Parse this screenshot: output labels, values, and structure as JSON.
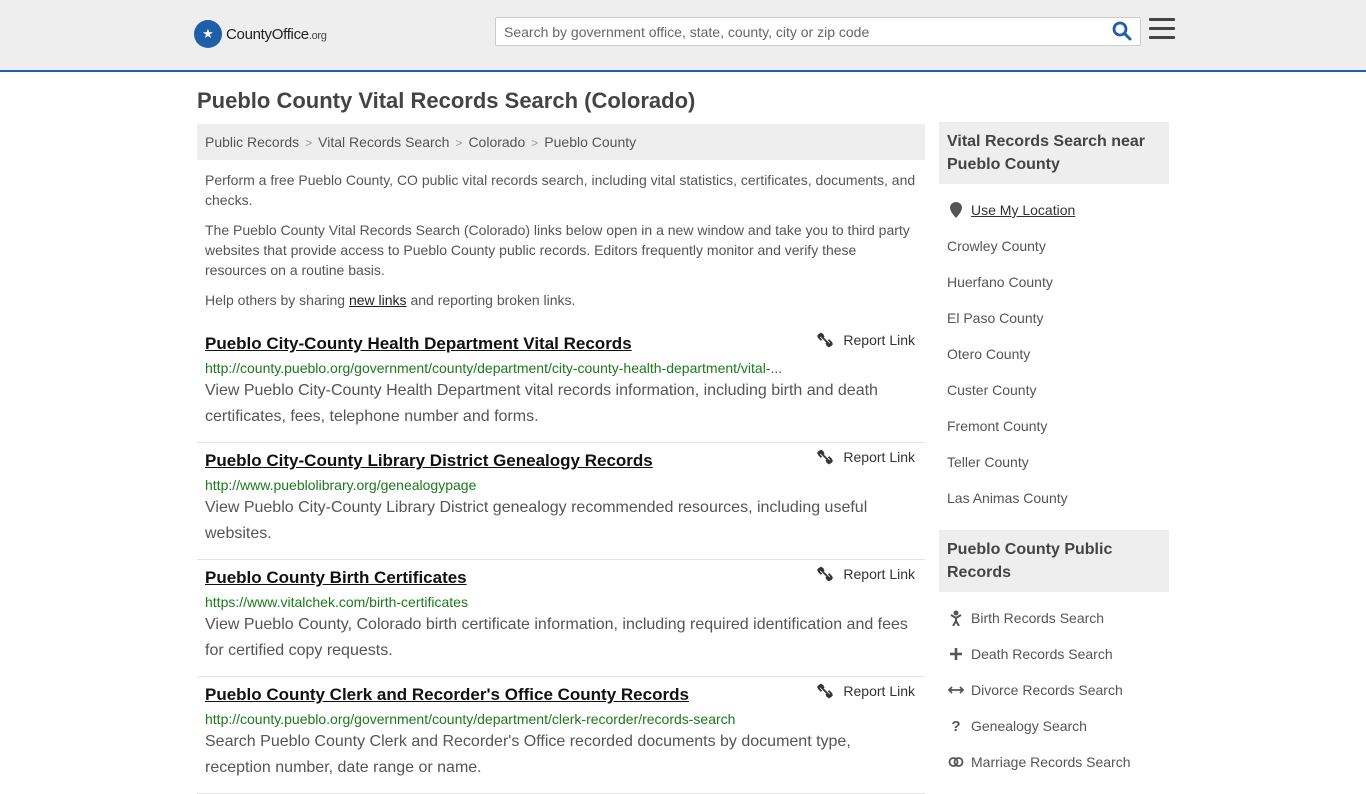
{
  "header": {
    "logo_main": "CountyOffice",
    "logo_org": ".org",
    "search_placeholder": "Search by government office, state, county, city or zip code"
  },
  "page_title": "Pueblo County Vital Records Search (Colorado)",
  "breadcrumb": [
    "Public Records",
    "Vital Records Search",
    "Colorado",
    "Pueblo County"
  ],
  "intro": {
    "p1": "Perform a free Pueblo County, CO public vital records search, including vital statistics, certificates, documents, and checks.",
    "p2": "The Pueblo County Vital Records Search (Colorado) links below open in a new window and take you to third party websites that provide access to Pueblo County public records. Editors frequently monitor and verify these resources on a routine basis.",
    "p3_before": "Help others by sharing ",
    "p3_link": "new links",
    "p3_after": " and reporting broken links."
  },
  "report_label": "Report Link",
  "results": [
    {
      "title": "Pueblo City-County Health Department Vital Records",
      "url": "http://county.pueblo.org/government/county/department/city-county-health-department/vital-...",
      "desc": "View Pueblo City-County Health Department vital records information, including birth and death certificates, fees, telephone number and forms."
    },
    {
      "title": "Pueblo City-County Library District Genealogy Records",
      "url": "http://www.pueblolibrary.org/genealogypage",
      "desc": "View Pueblo City-County Library District genealogy recommended resources, including useful websites."
    },
    {
      "title": "Pueblo County Birth Certificates",
      "url": "https://www.vitalchek.com/birth-certificates",
      "desc": "View Pueblo County, Colorado birth certificate information, including required identification and fees for certified copy requests."
    },
    {
      "title": "Pueblo County Clerk and Recorder's Office County Records",
      "url": "http://county.pueblo.org/government/county/department/clerk-recorder/records-search",
      "desc": "Search Pueblo County Clerk and Recorder's Office recorded documents by document type, reception number, date range or name."
    }
  ],
  "sidebar": {
    "nearby_heading": "Vital Records Search near Pueblo County",
    "use_location": "Use My Location",
    "nearby": [
      "Crowley County",
      "Huerfano County",
      "El Paso County",
      "Otero County",
      "Custer County",
      "Fremont County",
      "Teller County",
      "Las Animas County"
    ],
    "public_heading": "Pueblo County Public Records",
    "public_records": [
      {
        "label": "Birth Records Search",
        "icon": "baby-icon"
      },
      {
        "label": "Death Records Search",
        "icon": "cross-icon"
      },
      {
        "label": "Divorce Records Search",
        "icon": "arrows-split-icon"
      },
      {
        "label": "Genealogy Search",
        "icon": "question-icon"
      },
      {
        "label": "Marriage Records Search",
        "icon": "rings-icon"
      }
    ]
  },
  "colors": {
    "brand_blue": "#1f5ea8",
    "url_green": "#1a7a1a",
    "header_bg": "#eeeeee"
  }
}
